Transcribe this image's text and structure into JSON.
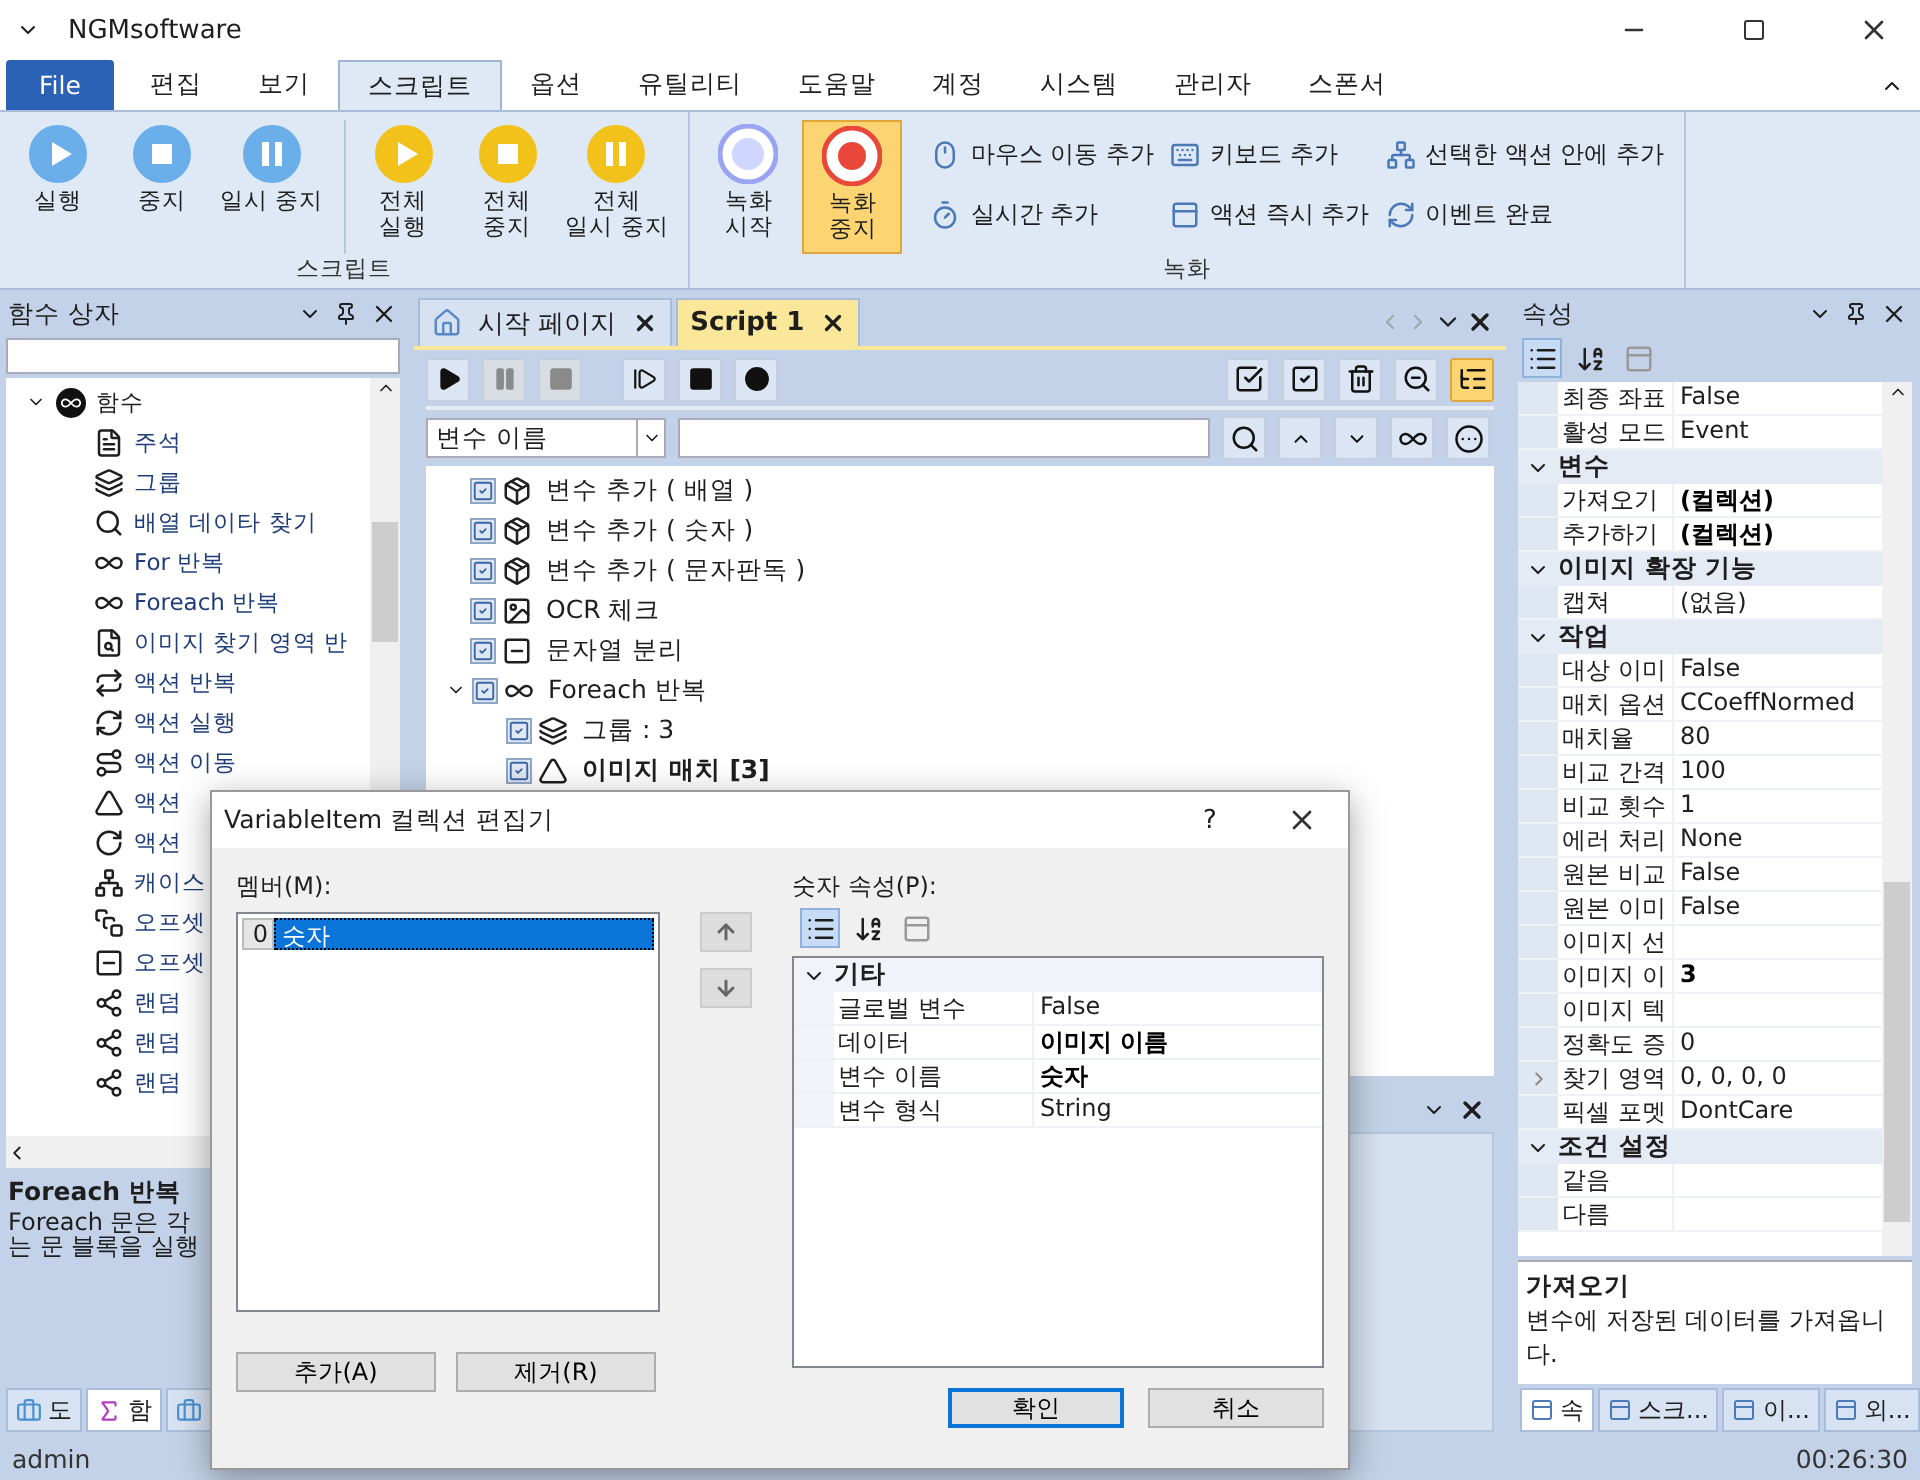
{
  "window": {
    "title": "NGMsoftware"
  },
  "ribbon": {
    "tabs": [
      {
        "label": "File",
        "kind": "file",
        "selected": false
      },
      {
        "label": "편집",
        "kind": "tab",
        "selected": false
      },
      {
        "label": "보기",
        "kind": "tab",
        "selected": false
      },
      {
        "label": "스크립트",
        "kind": "tab",
        "selected": true
      },
      {
        "label": "옵션",
        "kind": "tab",
        "selected": false
      },
      {
        "label": "유틸리티",
        "kind": "tab",
        "selected": false
      },
      {
        "label": "도움말",
        "kind": "tab",
        "selected": false
      },
      {
        "label": "계정",
        "kind": "tab",
        "selected": false
      },
      {
        "label": "시스템",
        "kind": "tab",
        "selected": false
      },
      {
        "label": "관리자",
        "kind": "tab",
        "selected": false
      },
      {
        "label": "스폰서",
        "kind": "tab",
        "selected": false
      }
    ],
    "groups": [
      {
        "label": "스크립트",
        "sections": [
          [
            {
              "kind": "play",
              "label": "실행",
              "color": "#6aaeea",
              "active": false
            },
            {
              "kind": "stop",
              "label": "중지",
              "color": "#6aaeea",
              "active": false
            },
            {
              "kind": "pause",
              "label": "일시 중지",
              "color": "#6aaeea",
              "active": false
            }
          ],
          [
            {
              "kind": "play",
              "label": "전체\n실행",
              "color": "#f2c21b",
              "active": false
            },
            {
              "kind": "stop",
              "label": "전체\n중지",
              "color": "#f2c21b",
              "active": false
            },
            {
              "kind": "pause",
              "label": "전체\n일시 중지",
              "color": "#f2c21b",
              "active": false
            }
          ]
        ]
      },
      {
        "label": "녹화",
        "sections": [
          [
            {
              "kind": "record-start",
              "label": "녹화\n시작",
              "color": "#9aa4f2",
              "active": false
            },
            {
              "kind": "record-stop",
              "label": "녹화\n중지",
              "color": "#e8473a",
              "active": true
            }
          ]
        ],
        "small_buttons": [
          {
            "label": "마우스 이동 추가"
          },
          {
            "label": "키보드 추가"
          },
          {
            "label": "선택한 액션 안에 추가"
          },
          {
            "label": "실시간 추가"
          },
          {
            "label": "액션 즉시 추가"
          },
          {
            "label": "이벤트 완료"
          }
        ]
      }
    ]
  },
  "left_panel": {
    "title": "함수 상자",
    "tree": {
      "label": "함수",
      "expanded": true,
      "children": [
        {
          "label": "주석"
        },
        {
          "label": "그룹"
        },
        {
          "label": "배열 데이타 찾기"
        },
        {
          "label": "For 반복"
        },
        {
          "label": "Foreach 반복"
        },
        {
          "label": "이미지 찾기 영역 반"
        },
        {
          "label": "액션 반복"
        },
        {
          "label": "액션 실행"
        },
        {
          "label": "액션 이동"
        },
        {
          "label": "액션"
        },
        {
          "label": "액션"
        },
        {
          "label": "캐이스"
        },
        {
          "label": "오프셋"
        },
        {
          "label": "오프셋"
        },
        {
          "label": "랜덤"
        },
        {
          "label": "랜덤"
        },
        {
          "label": "랜덤"
        }
      ]
    },
    "description": {
      "title": "Foreach 반복",
      "lines": [
        "Foreach 문은 각",
        "는 문 블록을 실행"
      ]
    },
    "bottom_tabs": [
      {
        "label": "도",
        "selected": false
      },
      {
        "label": "함",
        "selected": true
      },
      {
        "selected": false
      }
    ]
  },
  "editor": {
    "doc_tabs": [
      {
        "label": "시작 페이지",
        "selected": false
      },
      {
        "label": "Script 1",
        "selected": true
      }
    ],
    "toolbar_left": [
      {
        "kind": "play",
        "disabled": false
      },
      {
        "kind": "pause",
        "disabled": true
      },
      {
        "kind": "stop",
        "disabled": true
      },
      {
        "kind": "step",
        "disabled": false
      },
      {
        "kind": "run-box",
        "disabled": false
      },
      {
        "kind": "run-outline",
        "disabled": false
      }
    ],
    "toolbar_right": [
      {
        "kind": "check-all",
        "active": false
      },
      {
        "kind": "check",
        "active": false
      },
      {
        "kind": "delete",
        "active": false
      },
      {
        "kind": "zoom",
        "active": false
      },
      {
        "kind": "tree",
        "active": true
      }
    ],
    "search": {
      "dropdown": "변수 이름"
    },
    "tree": [
      {
        "label": "변수 추가 ( 배열 )",
        "checked": true,
        "current": false
      },
      {
        "label": "변수 추가 ( 숫자 )",
        "checked": true,
        "current": false
      },
      {
        "label": "변수 추가 ( 문자판독 )",
        "checked": true,
        "current": false
      },
      {
        "label": "OCR 체크",
        "checked": true,
        "current": false
      },
      {
        "label": "문자열 분리",
        "checked": true,
        "current": false
      },
      {
        "label": "Foreach 반복",
        "checked": true,
        "current": false,
        "expanded": true,
        "children": [
          {
            "label": "그룹 : 3",
            "checked": true,
            "current": false
          },
          {
            "label": "이미지 매치 [3]",
            "checked": true,
            "current": true
          }
        ]
      }
    ]
  },
  "properties": {
    "title": "속성",
    "categories": [
      {
        "rows": [
          {
            "name": "최종 좌표",
            "value": "False",
            "collapsed": false
          },
          {
            "name": "활성 모드",
            "value": "Event",
            "collapsed": false
          }
        ]
      },
      {
        "label": "변수",
        "expanded": true,
        "rows": [
          {
            "name": "가져오기",
            "value": "(컬렉션)",
            "bold": true,
            "collapsed": false
          },
          {
            "name": "추가하기",
            "value": "(컬렉션)",
            "bold": true,
            "collapsed": false
          }
        ]
      },
      {
        "label": "이미지 확장 기능",
        "expanded": true,
        "rows": [
          {
            "name": "캡쳐",
            "value": "(없음)",
            "collapsed": false
          }
        ]
      },
      {
        "label": "작업",
        "expanded": true,
        "rows": [
          {
            "name": "대상 이미",
            "value": "False",
            "collapsed": false
          },
          {
            "name": "매치 옵션",
            "value": "CCoeffNormed",
            "collapsed": false
          },
          {
            "name": "매치율",
            "value": "80",
            "collapsed": false
          },
          {
            "name": "비교 간격",
            "value": "100",
            "collapsed": false
          },
          {
            "name": "비교 횟수",
            "value": "1",
            "collapsed": false
          },
          {
            "name": "에러 처리",
            "value": "None",
            "collapsed": false
          },
          {
            "name": "원본 비교",
            "value": "False",
            "collapsed": false
          },
          {
            "name": "원본 이미",
            "value": "False",
            "collapsed": false
          },
          {
            "name": "이미지 선",
            "collapsed": false
          },
          {
            "name": "이미지 이",
            "value": "3",
            "bold": true,
            "collapsed": false
          },
          {
            "name": "이미지 텍",
            "collapsed": false
          },
          {
            "name": "정확도 증",
            "value": "0",
            "collapsed": false
          },
          {
            "name": "찾기 영역",
            "value": "0, 0, 0, 0",
            "collapsed": true
          },
          {
            "name": "픽셀 포멧",
            "value": "DontCare",
            "collapsed": false
          }
        ]
      },
      {
        "label": "조건 설정",
        "expanded": true,
        "rows": [
          {
            "name": "같음",
            "collapsed": false
          },
          {
            "name": "다름",
            "collapsed": false
          }
        ]
      }
    ],
    "description": {
      "title": "가져오기",
      "text": "변수에 저장된 데이터를 가져옵니다."
    },
    "bottom_tabs": [
      {
        "label": "속",
        "selected": true
      },
      {
        "label": "스크...",
        "selected": false
      },
      {
        "label": "이...",
        "selected": false
      },
      {
        "label": "외...",
        "selected": false
      }
    ]
  },
  "dialog": {
    "title": "VariableItem 컬렉션 편집기",
    "help": "?",
    "members_label": "멤버(M):",
    "members": [
      {
        "index": "0",
        "label": "숫자",
        "selected": true
      }
    ],
    "properties_label": "숫자 속성(P):",
    "categories": [
      {
        "label": "기타",
        "expanded": true,
        "rows": [
          {
            "name": "글로벌 변수",
            "value": "False",
            "collapsed": false
          },
          {
            "name": "데이터",
            "value": "이미지 이름",
            "bold": true,
            "collapsed": false
          },
          {
            "name": "변수 이름",
            "value": "숫자",
            "bold": true,
            "collapsed": false
          },
          {
            "name": "변수 형식",
            "value": "String",
            "collapsed": false
          }
        ]
      }
    ],
    "buttons": [
      {
        "label": "추가(A)",
        "default": false
      },
      {
        "label": "제거(R)",
        "default": false
      }
    ],
    "actions": [
      {
        "label": "확인",
        "default": true
      },
      {
        "label": "취소",
        "default": false
      }
    ]
  },
  "status_bar": {
    "user": "admin",
    "time": "00:26:30"
  }
}
